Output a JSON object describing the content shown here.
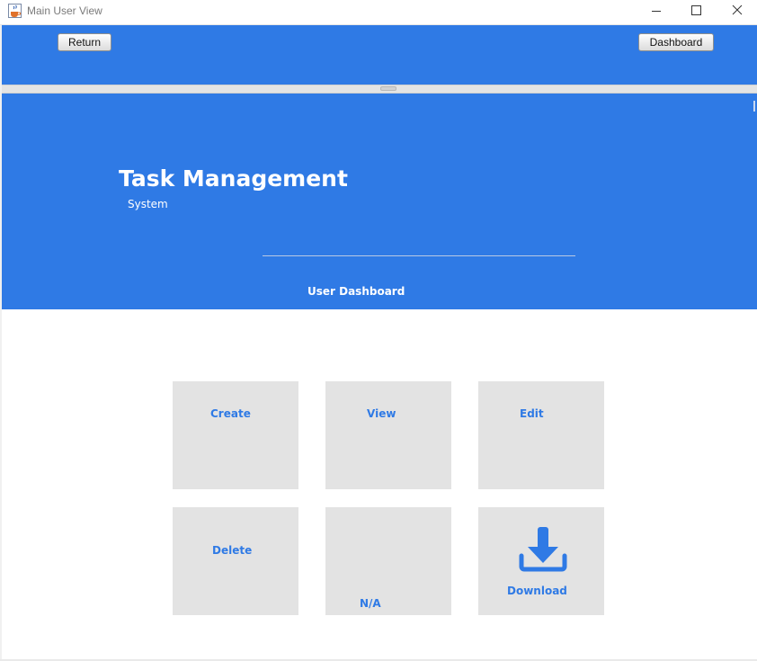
{
  "window": {
    "title": "Main User View",
    "min_icon": "minimize-icon",
    "max_icon": "maximize-icon",
    "close_icon": "close-icon",
    "app_icon": "java-cup-icon"
  },
  "toolbar": {
    "return_label": "Return",
    "dashboard_label": "Dashboard",
    "background": "#2f7ae5"
  },
  "header": {
    "title": "Task Management",
    "subtitle": "System",
    "section": "User Dashboard"
  },
  "tiles": [
    {
      "label": "Create"
    },
    {
      "label": "View"
    },
    {
      "label": "Edit"
    },
    {
      "label": "Delete"
    },
    {
      "label": "N/A"
    },
    {
      "label": "Download",
      "icon": "download-icon"
    }
  ],
  "colors": {
    "accent": "#2f7ae5",
    "tile_bg": "#e3e3e3"
  }
}
